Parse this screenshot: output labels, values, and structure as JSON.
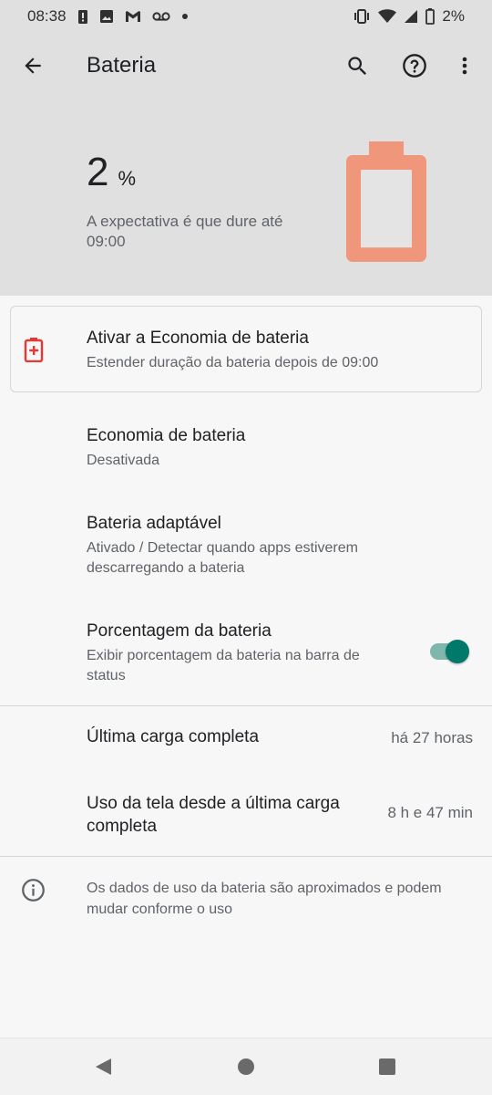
{
  "status_bar": {
    "time": "08:38",
    "battery_percent": "2%",
    "left_icons": [
      "alert-icon",
      "image-icon",
      "gmail-icon",
      "voicemail-icon",
      "dot-icon"
    ],
    "right_icons": [
      "vibrate-icon",
      "wifi-icon",
      "signal-icon",
      "battery-icon"
    ]
  },
  "header": {
    "title": "Bateria",
    "battery_number": "2",
    "battery_unit": "%",
    "estimate": "A expectativa é que dure até 09:00",
    "battery_level_fraction": 0.02,
    "battery_color": "#f0977b"
  },
  "saver_suggestion": {
    "title": "Ativar a Economia de bateria",
    "subtitle": "Estender duração da bateria depois de 09:00",
    "icon_color": "#e53935"
  },
  "settings": [
    {
      "title": "Economia de bateria",
      "subtitle": "Desativada"
    },
    {
      "title": "Bateria adaptável",
      "subtitle": "Ativado / Detectar quando apps estiverem descarregando a bateria"
    },
    {
      "title": "Porcentagem da bateria",
      "subtitle": "Exibir porcentagem da bateria na barra de status",
      "toggle_on": true
    }
  ],
  "usage": [
    {
      "title": "Última carga completa",
      "value": "há 27 horas"
    },
    {
      "title": "Uso da tela desde a última carga completa",
      "value": "8 h e 47 min"
    }
  ],
  "info_text": "Os dados de uso da bateria são aproximados e podem mudar conforme o uso",
  "colors": {
    "accent": "#00796b",
    "toggle_track": "#7fb7ad",
    "header_bg": "#e0e0e0"
  }
}
